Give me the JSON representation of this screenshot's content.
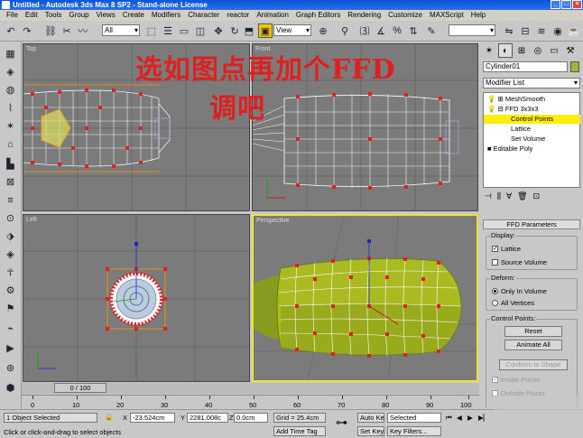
{
  "window": {
    "title": "Untitled - Autodesk 3ds Max 8 SP2 - Stand-alone License"
  },
  "menu": [
    "File",
    "Edit",
    "Tools",
    "Group",
    "Views",
    "Create",
    "Modifiers",
    "Character",
    "reactor",
    "Animation",
    "Graph Editors",
    "Rendering",
    "Customize",
    "MAXScript",
    "Help"
  ],
  "toolbar": {
    "selection_filter": "All",
    "ref_coord": "View"
  },
  "overlay": {
    "line1": "选如图点再加个FFD",
    "line2": "调吧"
  },
  "viewports": {
    "top": "Top",
    "front": "Front",
    "left": "Left",
    "perspective": "Perspective"
  },
  "command_panel": {
    "object_name": "Cylinder01",
    "modifier_list": "Modifier List",
    "stack": [
      "MeshSmooth",
      "FFD 3x3x3",
      "Control Points",
      "Lattice",
      "Set Volume",
      "Editable Poly"
    ],
    "rollout_title": "FFD Parameters",
    "display_group": "Display:",
    "lattice": "Lattice",
    "source_volume": "Source Volume",
    "deform_group": "Deform:",
    "only_in_volume": "Only In Volume",
    "all_vertices": "All Vertices",
    "control_points_group": "Control Points:",
    "reset": "Reset",
    "animate_all": "Animate All",
    "conform": "Conform to Shape",
    "inside_points": "Inside Points",
    "outside_points": "Outside Points"
  },
  "timeline": {
    "frame": "0 / 100",
    "ticks": [
      "0",
      "10",
      "20",
      "30",
      "40",
      "50",
      "60",
      "70",
      "80",
      "90",
      "100"
    ]
  },
  "status": {
    "selected": "1 Object Selected",
    "prompt": "Click or click-and-drag to select objects",
    "x": "-23.524cm",
    "y": "2281.008c",
    "z": "0.0cm",
    "grid": "Grid = 25.4cm",
    "add_time_tag": "Add Time Tag",
    "auto_key": "Auto Key",
    "set_key": "Set Key",
    "key_mode": "Selected",
    "key_filters": "Key Filters..."
  }
}
